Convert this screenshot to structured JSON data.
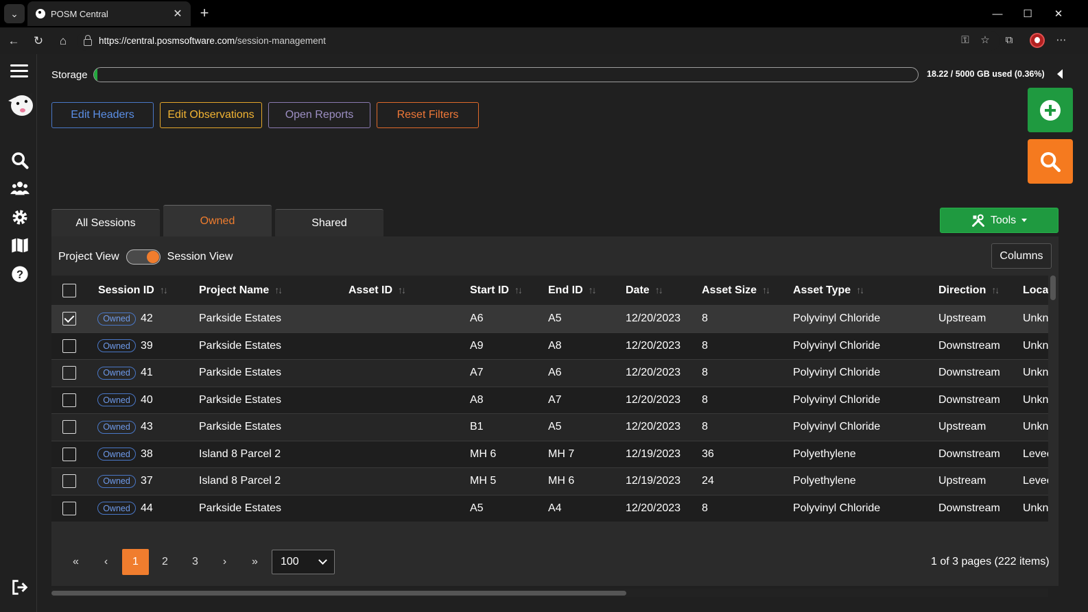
{
  "browser": {
    "tab_title": "POSM Central",
    "url_host": "https://central.posmsoftware.com",
    "url_path": "/session-management",
    "minimize": "—",
    "maximize": "☐",
    "close": "✕"
  },
  "storage": {
    "label": "Storage",
    "usage_text": "18.22 / 5000 GB used (0.36%)",
    "used_fraction": 0.0036
  },
  "toolbar": {
    "edit_headers": "Edit Headers",
    "edit_observations": "Edit Observations",
    "open_reports": "Open Reports",
    "reset_filters": "Reset Filters"
  },
  "tabs": {
    "all": "All Sessions",
    "owned": "Owned",
    "shared": "Shared",
    "tools": "Tools"
  },
  "view_toggle": {
    "left": "Project View",
    "right": "Session View"
  },
  "columns_button": "Columns",
  "table": {
    "headers": {
      "session_id": "Session ID",
      "project_name": "Project Name",
      "asset_id": "Asset ID",
      "start_id": "Start ID",
      "end_id": "End ID",
      "date": "Date",
      "asset_size": "Asset Size",
      "asset_type": "Asset Type",
      "direction": "Direction",
      "location": "Loca"
    },
    "badge": "Owned",
    "rows": [
      {
        "session_id": "42",
        "project": "Parkside Estates",
        "asset_id": "",
        "start": "A6",
        "end": "A5",
        "date": "12/20/2023",
        "size": "8",
        "type": "Polyvinyl Chloride",
        "direction": "Upstream",
        "location": "Unkn"
      },
      {
        "session_id": "39",
        "project": "Parkside Estates",
        "asset_id": "",
        "start": "A9",
        "end": "A8",
        "date": "12/20/2023",
        "size": "8",
        "type": "Polyvinyl Chloride",
        "direction": "Downstream",
        "location": "Unkn"
      },
      {
        "session_id": "41",
        "project": "Parkside Estates",
        "asset_id": "",
        "start": "A7",
        "end": "A6",
        "date": "12/20/2023",
        "size": "8",
        "type": "Polyvinyl Chloride",
        "direction": "Downstream",
        "location": "Unkn"
      },
      {
        "session_id": "40",
        "project": "Parkside Estates",
        "asset_id": "",
        "start": "A8",
        "end": "A7",
        "date": "12/20/2023",
        "size": "8",
        "type": "Polyvinyl Chloride",
        "direction": "Downstream",
        "location": "Unkn"
      },
      {
        "session_id": "43",
        "project": "Parkside Estates",
        "asset_id": "",
        "start": "B1",
        "end": "A5",
        "date": "12/20/2023",
        "size": "8",
        "type": "Polyvinyl Chloride",
        "direction": "Upstream",
        "location": "Unkn"
      },
      {
        "session_id": "38",
        "project": "Island 8 Parcel 2",
        "asset_id": "",
        "start": "MH 6",
        "end": "MH 7",
        "date": "12/19/2023",
        "size": "36",
        "type": "Polyethylene",
        "direction": "Downstream",
        "location": "Levee"
      },
      {
        "session_id": "37",
        "project": "Island 8 Parcel 2",
        "asset_id": "",
        "start": "MH 5",
        "end": "MH 6",
        "date": "12/19/2023",
        "size": "24",
        "type": "Polyethylene",
        "direction": "Upstream",
        "location": "Levee"
      },
      {
        "session_id": "44",
        "project": "Parkside Estates",
        "asset_id": "",
        "start": "A5",
        "end": "A4",
        "date": "12/20/2023",
        "size": "8",
        "type": "Polyvinyl Chloride",
        "direction": "Downstream",
        "location": "Unkn"
      }
    ]
  },
  "pager": {
    "first": "«",
    "prev": "‹",
    "pages": [
      "1",
      "2",
      "3"
    ],
    "next": "›",
    "last": "»",
    "page_size": "100",
    "info": "1 of 3 pages (222 items)"
  }
}
